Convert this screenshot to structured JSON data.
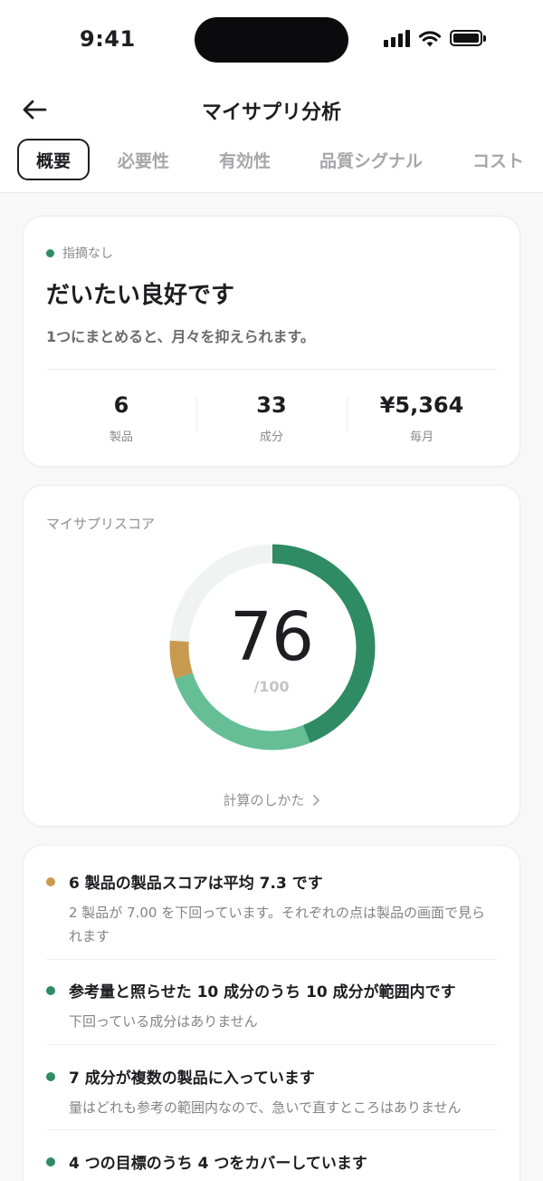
{
  "status_bar": {
    "time": "9:41"
  },
  "header": {
    "title": "マイサプリ分析",
    "tabs": [
      {
        "label": "概要",
        "active": true
      },
      {
        "label": "必要性",
        "active": false
      },
      {
        "label": "有効性",
        "active": false
      },
      {
        "label": "品質シグナル",
        "active": false
      },
      {
        "label": "コスト",
        "active": false
      }
    ]
  },
  "summary": {
    "status": "指摘なし",
    "title": "だいたい良好です",
    "description": "1つにまとめると、月々を抑えられます。",
    "stats": [
      {
        "value": "6",
        "label": "製品"
      },
      {
        "value": "33",
        "label": "成分"
      },
      {
        "value": "¥5,364",
        "label": "毎月"
      }
    ]
  },
  "score": {
    "caption": "マイサプリスコア",
    "value": "76",
    "max": "/100",
    "link": "計算のしかた",
    "segments": [
      {
        "name": "dark-green",
        "fraction": 0.44,
        "color": "#2e8b64"
      },
      {
        "name": "light-green",
        "fraction": 0.26,
        "color": "#66be96"
      },
      {
        "name": "amber",
        "fraction": 0.06,
        "color": "#c89a50"
      }
    ],
    "track_color": "#f1f2f2"
  },
  "findings": [
    {
      "dot": "#c89a50",
      "title": "6 製品の製品スコアは平均 7.3 です",
      "description": "2 製品が 7.00 を下回っています。それぞれの点は製品の画面で見られます"
    },
    {
      "dot": "#2e8b64",
      "title": "参考量と照らせた 10 成分のうち 10 成分が範囲内です",
      "description": "下回っている成分はありません"
    },
    {
      "dot": "#2e8b64",
      "title": "7 成分が複数の製品に入っています",
      "description": "量はどれも参考の範囲内なので、急いで直すところはありません"
    },
    {
      "dot": "#2e8b64",
      "title": "4 つの目標のうち 4 つをカバーしています",
      "description": ""
    }
  ]
}
